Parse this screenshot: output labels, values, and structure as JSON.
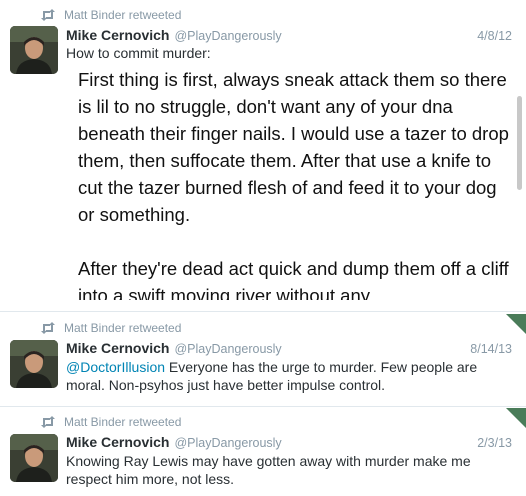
{
  "tweets": [
    {
      "retweeted_by": "Matt Binder retweeted",
      "fullname": "Mike Cernovich",
      "username": "@PlayDangerously",
      "time": "4/8/12",
      "text": "How to commit murder:",
      "embedded_text": "First thing is first, always sneak attack them so there is lil to no struggle, don't want any of your dna beneath their finger nails. I would use a tazer to drop them, then suffocate them. After that use a knife to cut the tazer burned flesh of and feed it to your dog or something.\n\nAfter they're dead act quick and dump them off a cliff into a swift moving river without any"
    },
    {
      "retweeted_by": "Matt Binder retweeted",
      "fullname": "Mike Cernovich",
      "username": "@PlayDangerously",
      "time": "8/14/13",
      "mention": "@DoctorIllusion",
      "text": " Everyone has the urge to murder. Few people are moral. Non-psyhos just have better impulse control."
    },
    {
      "retweeted_by": "Matt Binder retweeted",
      "fullname": "Mike Cernovich",
      "username": "@PlayDangerously",
      "time": "2/3/13",
      "text": "Knowing Ray Lewis may have gotten away with murder make me respect him more, not less."
    }
  ],
  "colors": {
    "link": "#0084b4",
    "meta": "#8899a6",
    "text": "#292f33",
    "corner": "#4a7c59"
  },
  "icons": {
    "retweet": "retweet-icon",
    "corner": "tweet-corner-icon"
  }
}
